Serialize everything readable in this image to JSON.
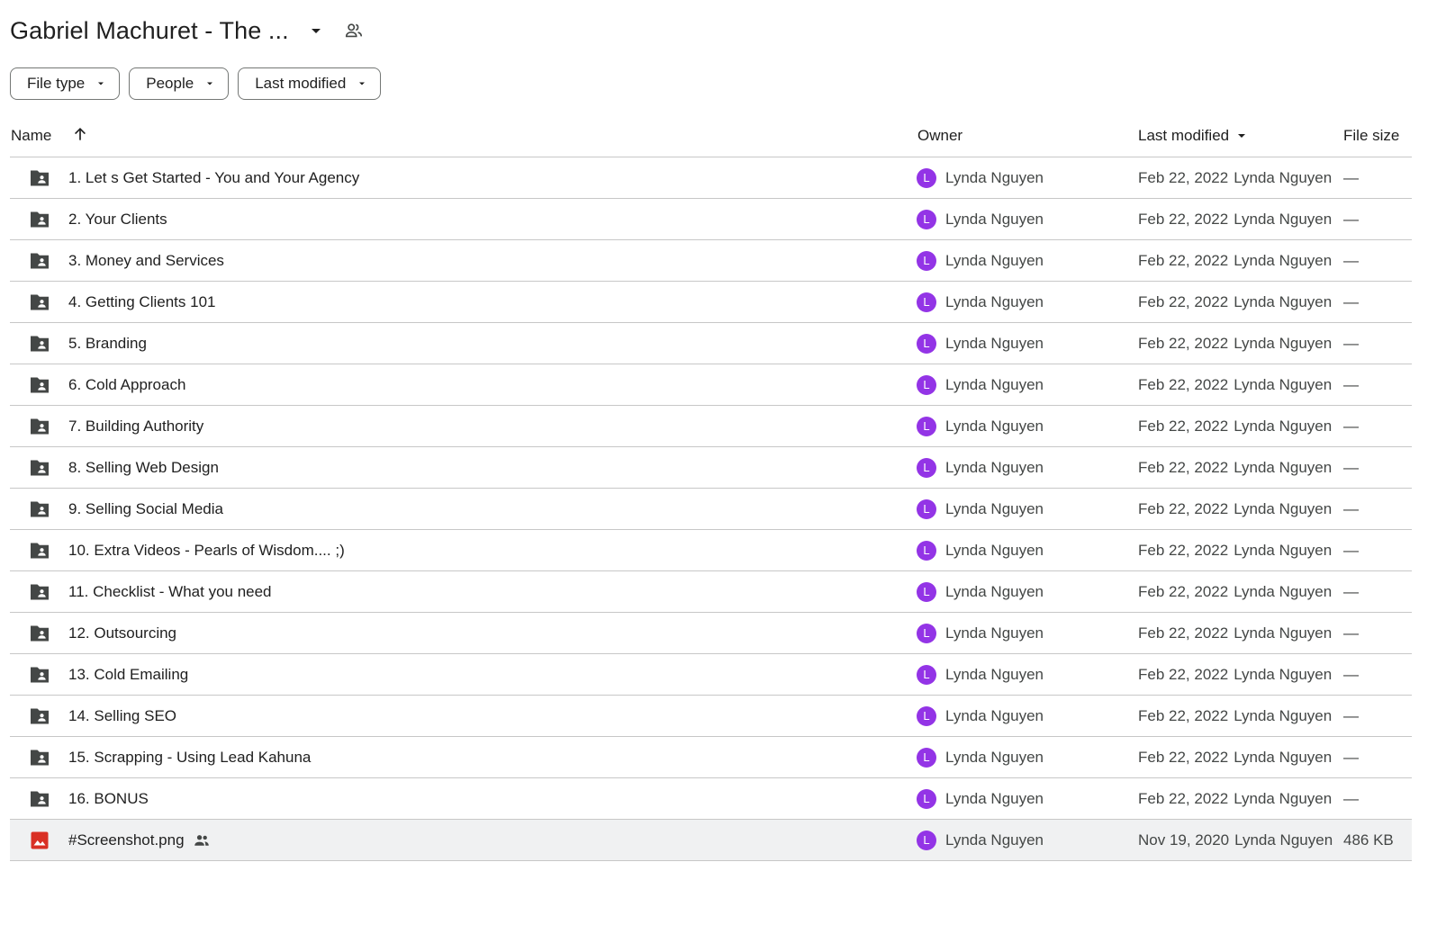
{
  "header": {
    "title": "Gabriel Machuret - The ...",
    "title_menu_icon": "caret-down-icon",
    "shared_icon": "people-icon"
  },
  "filters": [
    {
      "label": "File type"
    },
    {
      "label": "People"
    },
    {
      "label": "Last modified"
    }
  ],
  "columns": {
    "name": "Name",
    "owner": "Owner",
    "last_modified": "Last modified",
    "file_size": "File size",
    "sort_icon": "arrow-up-icon",
    "modified_sort_icon": "caret-down-icon"
  },
  "colors": {
    "avatar": "#9334e6",
    "folder_icon": "#444746",
    "image_icon": "#d93025",
    "selected_row": "#f0f1f2"
  },
  "rows": [
    {
      "icon": "shared-folder-icon",
      "name": "1. Let s Get Started - You and Your Agency",
      "owner_initial": "L",
      "owner": "Lynda Nguyen",
      "modified_date": "Feb 22, 2022",
      "modified_by": "Lynda Nguyen",
      "size": "—",
      "shared": false,
      "selected": false
    },
    {
      "icon": "shared-folder-icon",
      "name": "2. Your Clients",
      "owner_initial": "L",
      "owner": "Lynda Nguyen",
      "modified_date": "Feb 22, 2022",
      "modified_by": "Lynda Nguyen",
      "size": "—",
      "shared": false,
      "selected": false
    },
    {
      "icon": "shared-folder-icon",
      "name": "3. Money and Services",
      "owner_initial": "L",
      "owner": "Lynda Nguyen",
      "modified_date": "Feb 22, 2022",
      "modified_by": "Lynda Nguyen",
      "size": "—",
      "shared": false,
      "selected": false
    },
    {
      "icon": "shared-folder-icon",
      "name": "4. Getting Clients 101",
      "owner_initial": "L",
      "owner": "Lynda Nguyen",
      "modified_date": "Feb 22, 2022",
      "modified_by": "Lynda Nguyen",
      "size": "—",
      "shared": false,
      "selected": false
    },
    {
      "icon": "shared-folder-icon",
      "name": "5. Branding",
      "owner_initial": "L",
      "owner": "Lynda Nguyen",
      "modified_date": "Feb 22, 2022",
      "modified_by": "Lynda Nguyen",
      "size": "—",
      "shared": false,
      "selected": false
    },
    {
      "icon": "shared-folder-icon",
      "name": "6. Cold Approach",
      "owner_initial": "L",
      "owner": "Lynda Nguyen",
      "modified_date": "Feb 22, 2022",
      "modified_by": "Lynda Nguyen",
      "size": "—",
      "shared": false,
      "selected": false
    },
    {
      "icon": "shared-folder-icon",
      "name": "7. Building Authority",
      "owner_initial": "L",
      "owner": "Lynda Nguyen",
      "modified_date": "Feb 22, 2022",
      "modified_by": "Lynda Nguyen",
      "size": "—",
      "shared": false,
      "selected": false
    },
    {
      "icon": "shared-folder-icon",
      "name": "8. Selling Web Design",
      "owner_initial": "L",
      "owner": "Lynda Nguyen",
      "modified_date": "Feb 22, 2022",
      "modified_by": "Lynda Nguyen",
      "size": "—",
      "shared": false,
      "selected": false
    },
    {
      "icon": "shared-folder-icon",
      "name": "9. Selling Social Media",
      "owner_initial": "L",
      "owner": "Lynda Nguyen",
      "modified_date": "Feb 22, 2022",
      "modified_by": "Lynda Nguyen",
      "size": "—",
      "shared": false,
      "selected": false
    },
    {
      "icon": "shared-folder-icon",
      "name": "10. Extra Videos - Pearls of Wisdom.... ;)",
      "owner_initial": "L",
      "owner": "Lynda Nguyen",
      "modified_date": "Feb 22, 2022",
      "modified_by": "Lynda Nguyen",
      "size": "—",
      "shared": false,
      "selected": false
    },
    {
      "icon": "shared-folder-icon",
      "name": "11. Checklist - What you need",
      "owner_initial": "L",
      "owner": "Lynda Nguyen",
      "modified_date": "Feb 22, 2022",
      "modified_by": "Lynda Nguyen",
      "size": "—",
      "shared": false,
      "selected": false
    },
    {
      "icon": "shared-folder-icon",
      "name": "12. Outsourcing",
      "owner_initial": "L",
      "owner": "Lynda Nguyen",
      "modified_date": "Feb 22, 2022",
      "modified_by": "Lynda Nguyen",
      "size": "—",
      "shared": false,
      "selected": false
    },
    {
      "icon": "shared-folder-icon",
      "name": "13. Cold Emailing",
      "owner_initial": "L",
      "owner": "Lynda Nguyen",
      "modified_date": "Feb 22, 2022",
      "modified_by": "Lynda Nguyen",
      "size": "—",
      "shared": false,
      "selected": false
    },
    {
      "icon": "shared-folder-icon",
      "name": "14. Selling SEO",
      "owner_initial": "L",
      "owner": "Lynda Nguyen",
      "modified_date": "Feb 22, 2022",
      "modified_by": "Lynda Nguyen",
      "size": "—",
      "shared": false,
      "selected": false
    },
    {
      "icon": "shared-folder-icon",
      "name": "15. Scrapping - Using Lead Kahuna",
      "owner_initial": "L",
      "owner": "Lynda Nguyen",
      "modified_date": "Feb 22, 2022",
      "modified_by": "Lynda Nguyen",
      "size": "—",
      "shared": false,
      "selected": false
    },
    {
      "icon": "shared-folder-icon",
      "name": "16. BONUS",
      "owner_initial": "L",
      "owner": "Lynda Nguyen",
      "modified_date": "Feb 22, 2022",
      "modified_by": "Lynda Nguyen",
      "size": "—",
      "shared": false,
      "selected": false
    },
    {
      "icon": "image-file-icon",
      "name": "#Screenshot.png",
      "owner_initial": "L",
      "owner": "Lynda Nguyen",
      "modified_date": "Nov 19, 2020",
      "modified_by": "Lynda Nguyen",
      "size": "486 KB",
      "shared": true,
      "selected": true
    }
  ]
}
